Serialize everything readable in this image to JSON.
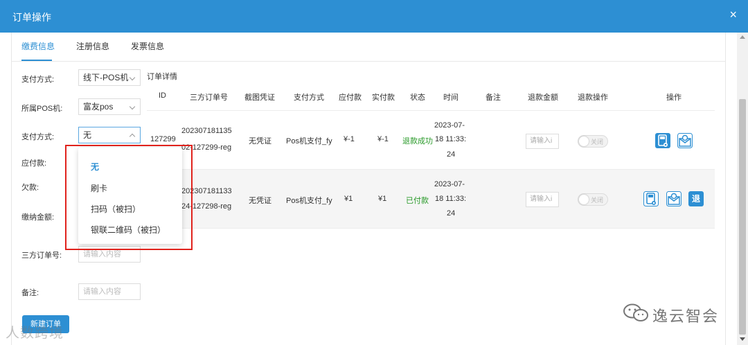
{
  "dialog": {
    "title": "订单操作",
    "close_glyph": "×"
  },
  "tabs": [
    "缴费信息",
    "注册信息",
    "发票信息"
  ],
  "form": {
    "pay_method_label": "支付方式:",
    "pay_method_value": "线下-POS机",
    "pos_label": "所属POS机:",
    "pos_value": "富友pos",
    "pay_type_label": "支付方式:",
    "pay_type_value": "无",
    "payable_label": "应付款:",
    "owed_label": "欠款:",
    "pay_amount_label": "缴纳金额:",
    "third_order_label": "三方订单号:",
    "third_order_placeholder": "请输入内容",
    "remark_label": "备注:",
    "remark_placeholder": "请输入内容"
  },
  "dropdown": {
    "options": [
      "无",
      "刷卡",
      "扫码（被扫）",
      "银联二维码（被扫）"
    ],
    "selected": "无"
  },
  "orders": {
    "title": "订单详情",
    "headers": [
      "ID",
      "三方订单号",
      "截图凭证",
      "支付方式",
      "应付款",
      "实付款",
      "状态",
      "时间",
      "备注",
      "退款金额",
      "退款操作",
      "操作"
    ],
    "rows": [
      {
        "id": "127299",
        "order_no_1": "202307181135",
        "order_no_2": "02-127299-reg",
        "proof": "无凭证",
        "method": "Pos机支付_fy",
        "payable": "¥-1",
        "paid": "¥-1",
        "status": "退款成功",
        "time_1": "2023-07-",
        "time_2": "18 11:33:",
        "time_3": "24",
        "refund_placeholder": "请输入i",
        "toggle": "关闭"
      },
      {
        "id": "",
        "order_no_1": "202307181133",
        "order_no_2": "24-127298-reg",
        "proof": "无凭证",
        "method": "Pos机支付_fy",
        "payable": "¥1",
        "paid": "¥1",
        "status": "已付款",
        "time_1": "2023-07-",
        "time_2": "18 11:33:",
        "time_3": "24",
        "refund_placeholder": "请输入i",
        "toggle": "关闭",
        "refund_button": "退"
      }
    ]
  },
  "submit_button": "新建订单",
  "watermarks": {
    "left": "人数跨境",
    "right": "逸云智会"
  },
  "colors": {
    "primary": "#2d8fd3",
    "success": "#2a9a2a",
    "highlight_box": "#e0221c"
  }
}
